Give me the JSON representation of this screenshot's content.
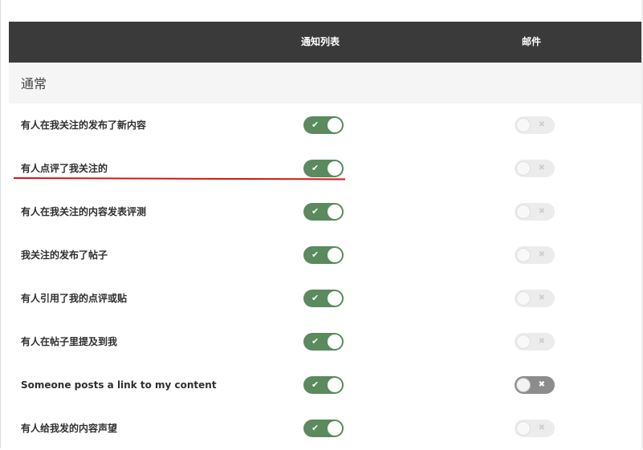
{
  "header": {
    "notify_col": "通知列表",
    "email_col": "邮件"
  },
  "section": {
    "title": "通常"
  },
  "rows": [
    {
      "label": "有人在我关注的发布了新内容",
      "notify": true,
      "email": false
    },
    {
      "label": "有人点评了我关注的",
      "notify": true,
      "email": false
    },
    {
      "label": "有人在我关注的内容发表评测",
      "notify": true,
      "email": false
    },
    {
      "label": "我关注的发布了帖子",
      "notify": true,
      "email": false
    },
    {
      "label": "有人引用了我的点评或贴",
      "notify": true,
      "email": false
    },
    {
      "label": "有人在帖子里提及到我",
      "notify": true,
      "email": false
    },
    {
      "label": "Someone posts a link to my content",
      "notify": true,
      "email": false
    },
    {
      "label": "有人给我发的内容声望",
      "notify": true,
      "email": false
    }
  ],
  "icons": {
    "on": "check-icon",
    "off": "x-icon"
  },
  "colors": {
    "header_bg": "#3a3a3a",
    "toggle_on": "#5a8a5e",
    "toggle_off": "#ececec",
    "annotation": "#d4141a"
  }
}
